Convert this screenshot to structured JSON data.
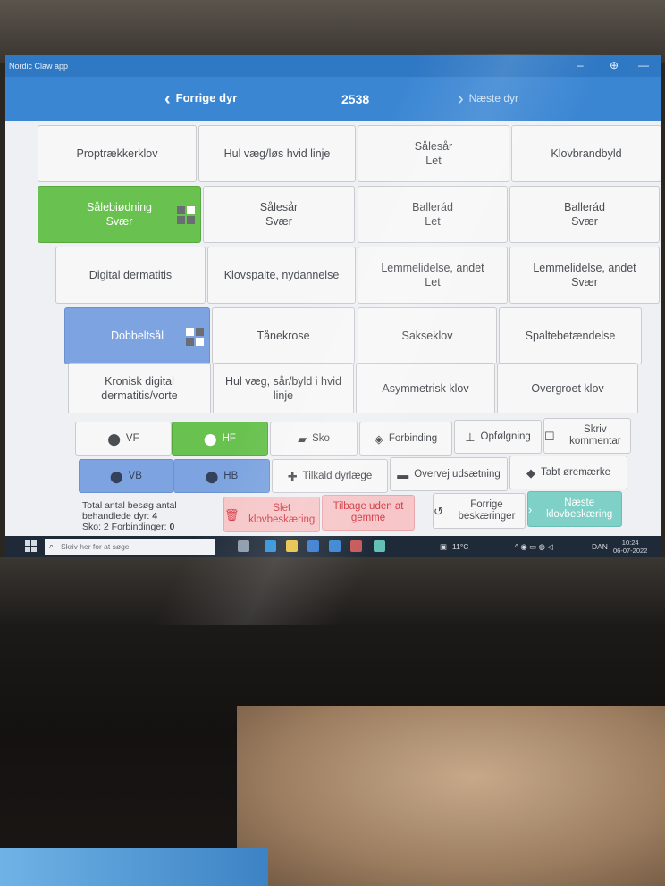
{
  "window": {
    "app_title": "Nordic Claw app"
  },
  "header": {
    "prev_label": "Forrige dyr",
    "animal_id": "2538",
    "next_label": "Næste dyr"
  },
  "tiles": [
    {
      "label": "Proptrækkerklov",
      "sub": "",
      "state": "normal"
    },
    {
      "label": "Hul væg/løs hvid linje",
      "sub": "",
      "state": "normal"
    },
    {
      "label": "Sålesår",
      "sub": "Let",
      "state": "normal"
    },
    {
      "label": "Klovbrandbyld",
      "sub": "",
      "state": "normal"
    },
    {
      "label": "Sålebiødning",
      "sub": "Svær",
      "state": "green"
    },
    {
      "label": "Sålesår",
      "sub": "Svær",
      "state": "normal"
    },
    {
      "label": "Ballerád",
      "sub": "Let",
      "state": "normal"
    },
    {
      "label": "Ballerád",
      "sub": "Svær",
      "state": "normal"
    },
    {
      "label": "Digital dermatitis",
      "sub": "",
      "state": "normal"
    },
    {
      "label": "Klovspalte, nydannelse",
      "sub": "",
      "state": "normal"
    },
    {
      "label": "Lemmelidelse, andet",
      "sub": "Let",
      "state": "normal"
    },
    {
      "label": "Lemmelidelse, andet",
      "sub": "Svær",
      "state": "normal"
    },
    {
      "label": "Dobbeltsål",
      "sub": "",
      "state": "blue"
    },
    {
      "label": "Tånekrose",
      "sub": "",
      "state": "normal"
    },
    {
      "label": "Sakseklov",
      "sub": "",
      "state": "normal"
    },
    {
      "label": "Spaltebetændelse",
      "sub": "",
      "state": "normal"
    },
    {
      "label": "Kronisk digital",
      "sub": "dermatitis/vorte",
      "state": "normal"
    },
    {
      "label": "Hul væg, sår/byld i hvid",
      "sub": "linje",
      "state": "normal"
    },
    {
      "label": "Asymmetrisk klov",
      "sub": "",
      "state": "normal"
    },
    {
      "label": "Overgroet klov",
      "sub": "",
      "state": "normal"
    }
  ],
  "hooves": {
    "vf": "VF",
    "hf": "HF",
    "vb": "VB",
    "hb": "HB"
  },
  "actions": {
    "sko": "Sko",
    "forbinding": "Forbinding",
    "opfolgning": "Opfølgning",
    "skriv_kommentar": "Skriv kommentar",
    "tilkald_dyrlaege": "Tilkald dyrlæge",
    "overvej_udsaetning": "Overvej udsætning",
    "tabt_oremaerke": "Tabt øremærke",
    "slet": "Slet klovbeskæring",
    "tilbage": "Tilbage uden at gemme",
    "forrige_beskaeringer": "Forrige beskæringer",
    "naeste_klovbeskaering": "Næste klovbeskæring"
  },
  "stats": {
    "line1": "Total antal besøg antal",
    "line2_label": "behandlede dyr:",
    "line2_value": "4",
    "line3_label": "Sko: 2 Forbindinger:",
    "line3_value": "0"
  },
  "taskbar": {
    "search_placeholder": "Skriv her for at søge",
    "temperature": "11°C",
    "language": "DAN",
    "time": "10:24",
    "date": "06-07-2022"
  },
  "colors": {
    "header_blue": "#3b86d3",
    "selected_green": "#69c24f",
    "selected_blue": "#7da4e0",
    "danger_pink": "#f6c6c8",
    "next_teal": "#7fd0c6"
  }
}
